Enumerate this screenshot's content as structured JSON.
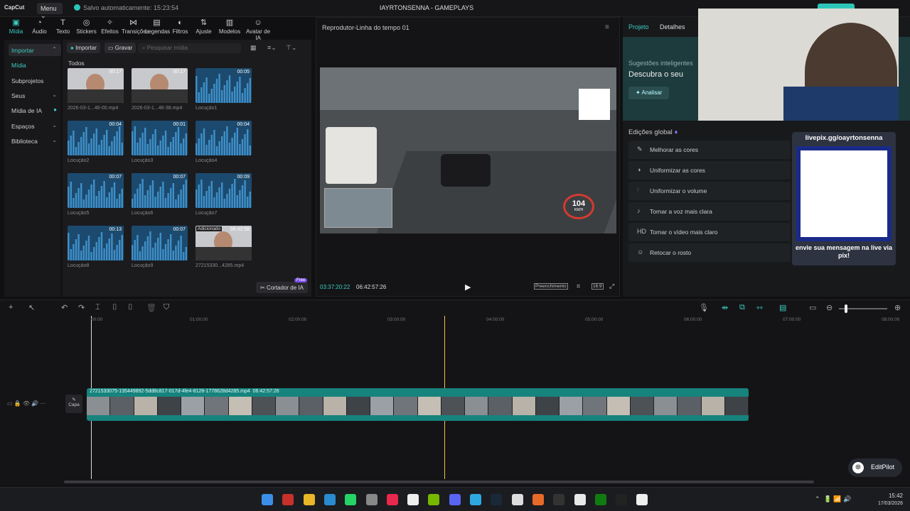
{
  "titlebar": {
    "logo": "CapCut",
    "menu": "Menu",
    "autosave": "Salvo automaticamente: 15:23:54",
    "project": "IAYRTONSENNA - GAMEPLAYS"
  },
  "toolbar": [
    {
      "label": "Mídia",
      "icon": "media-icon"
    },
    {
      "label": "Áudio",
      "icon": "audio-icon"
    },
    {
      "label": "Texto",
      "icon": "text-icon"
    },
    {
      "label": "Stickers",
      "icon": "sticker-icon"
    },
    {
      "label": "Efeitos",
      "icon": "effects-icon"
    },
    {
      "label": "Transições",
      "icon": "transitions-icon"
    },
    {
      "label": "Legendas",
      "icon": "captions-icon"
    },
    {
      "label": "Filtros",
      "icon": "filters-icon"
    },
    {
      "label": "Ajuste",
      "icon": "adjust-icon"
    },
    {
      "label": "Modelos",
      "icon": "templates-icon"
    },
    {
      "label": "Avatar de IA",
      "icon": "ai-avatar-icon"
    }
  ],
  "sidebar": {
    "items": [
      "Importar",
      "Mídia",
      "Subprojetos",
      "Seus",
      "Mídia de IA",
      "Espaços",
      "Biblioteca"
    ]
  },
  "media": {
    "import": "Importar",
    "record": "Gravar",
    "search_placeholder": "Pesquisar mídia",
    "section": "Todos",
    "items": [
      {
        "name": "2026-03-1...46-00.mp4",
        "dur": "00:17",
        "kind": "video"
      },
      {
        "name": "2026-03-1...46-38.mp4",
        "dur": "00:17",
        "kind": "video"
      },
      {
        "name": "Locução1",
        "dur": "00:05",
        "kind": "audio"
      },
      {
        "name": "Locução2",
        "dur": "00:04",
        "kind": "audio"
      },
      {
        "name": "Locução3",
        "dur": "00:01",
        "kind": "audio"
      },
      {
        "name": "Locução4",
        "dur": "00:04",
        "kind": "audio"
      },
      {
        "name": "Locução5",
        "dur": "00:07",
        "kind": "audio"
      },
      {
        "name": "Locução6",
        "dur": "00:07",
        "kind": "audio"
      },
      {
        "name": "Locução7",
        "dur": "00:09",
        "kind": "audio"
      },
      {
        "name": "Locução8",
        "dur": "00:13",
        "kind": "audio"
      },
      {
        "name": "Locução9",
        "dur": "00:07",
        "kind": "audio"
      },
      {
        "name": "27215330...4285.mp4",
        "dur": "06:42:58",
        "kind": "video",
        "badge": "Adicionado"
      }
    ],
    "cutter": "Cortador de IA",
    "cutter_badge": "Free"
  },
  "player": {
    "title": "Reprodutor-Linha do tempo 01",
    "time_current": "03:37:20:22",
    "time_total": "06:42:57:26",
    "fill_mode": "Preenchimento",
    "ratio": "16:9",
    "speed": "104",
    "speed_unit": "KM/H"
  },
  "right": {
    "tab_project": "Projeto",
    "tab_details": "Detalhes",
    "suggestions": "Sugestões inteligentes",
    "discover": "Descubra o seu",
    "analyze": "Analisar",
    "global_edits": "Edições global",
    "actions": [
      {
        "label": "Melhorar as cores",
        "icon": "wand-icon"
      },
      {
        "label": "Uniformizar as cores",
        "icon": "color-match-icon"
      },
      {
        "label": "Uniformizar o volume",
        "icon": "volume-eq-icon"
      },
      {
        "label": "Tornar a voz mais clara",
        "icon": "voice-icon"
      },
      {
        "label": "Tornar o vídeo mais claro",
        "icon": "hd-icon"
      },
      {
        "label": "Retocar o rosto",
        "icon": "face-icon"
      }
    ]
  },
  "overlay": {
    "url": "livepix.gg/oayrtonsenna",
    "message": "envie sua mensagem na live via pix!"
  },
  "timeline": {
    "ticks": [
      "00:00",
      "01:00:00",
      "02:00:00",
      "03:00:00",
      "04:00:00",
      "05:00:00",
      "06:00:00",
      "07:00:00",
      "08:00:00"
    ],
    "clip_name": "2721533075-135449892-5dd8c817-017d-4fe4-8128-1778628d4285.mp4",
    "clip_duration": "06:42:57:26",
    "cover": "Capa"
  },
  "editpilot": "EditPilot",
  "clock": {
    "time": "15:42",
    "date": "17/03/2026"
  }
}
